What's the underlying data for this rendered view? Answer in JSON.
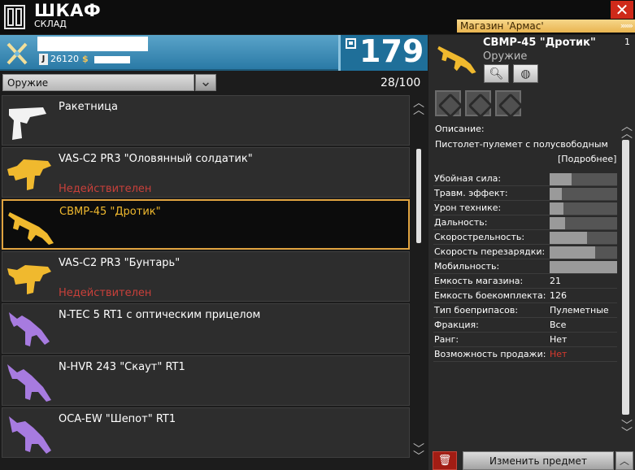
{
  "window": {
    "title": "ШКАФ",
    "subtitle": "СКЛАД",
    "shop_link": "Магазин 'Армас'",
    "shop_arrows": "»»»",
    "close_label": "✕"
  },
  "profile": {
    "credits": "26120",
    "j_badge": "J",
    "coin_symbol": "$",
    "capacity": "179"
  },
  "filter": {
    "selected": "Оружие",
    "count": "28/100"
  },
  "items": [
    {
      "name": "Ракетница",
      "status": "",
      "icon": "flare-pistol-icon",
      "color": "#f2f2f2"
    },
    {
      "name": "VAS-C2 PR3 \"Оловянный солдатик\"",
      "status": "Недействителен",
      "icon": "assault-rifle-icon",
      "color": "#f0b92e"
    },
    {
      "name": "СВМР-45 \"Дротик\"",
      "status": "",
      "icon": "smg-icon",
      "color": "#f0b92e",
      "selected": true
    },
    {
      "name": "VAS-C2 PR3 \"Бунтарь\"",
      "status": "Недействителен",
      "icon": "assault-rifle-icon",
      "color": "#f0b92e"
    },
    {
      "name": "N-TEC 5 RT1 с оптическим прицелом",
      "status": "",
      "icon": "scoped-rifle-icon",
      "color": "#a77be0"
    },
    {
      "name": "N-HVR 243 \"Скаут\" RT1",
      "status": "",
      "icon": "sniper-rifle-icon",
      "color": "#a77be0"
    },
    {
      "name": "OCA-EW \"Шепот\" RT1",
      "status": "",
      "icon": "silenced-rifle-icon",
      "color": "#a77be0"
    }
  ],
  "detail": {
    "title": "СВМР-45 \"Дротик\"",
    "quantity": "1",
    "category": "Оружие",
    "description_label": "Описание:",
    "description": "Пистолет-пулемет с полусвободным",
    "more_link": "[Подробнее]",
    "stats": [
      {
        "label": "Убойная сила:",
        "level": 0.33
      },
      {
        "label": "Травм. эффект:",
        "level": 0.18
      },
      {
        "label": "Урон технике:",
        "level": 0.2
      },
      {
        "label": "Дальность:",
        "level": 0.23
      },
      {
        "label": "Скорострельность:",
        "level": 0.55
      },
      {
        "label": "Скорость перезарядки:",
        "level": 0.68
      },
      {
        "label": "Мобильность:",
        "level": 1.0
      }
    ],
    "props": [
      {
        "label": "Емкость магазина:",
        "value": "21"
      },
      {
        "label": "Емкость боекомплекта:",
        "value": "126"
      },
      {
        "label": "Тип боеприпасов:",
        "value": "Пулеметные"
      },
      {
        "label": "Фракция:",
        "value": "Все"
      },
      {
        "label": "Ранг:",
        "value": "Нет"
      },
      {
        "label": "Возможность продажи:",
        "value": "Нет",
        "red": true
      }
    ]
  },
  "buttons": {
    "change_item": "Изменить предмет"
  }
}
